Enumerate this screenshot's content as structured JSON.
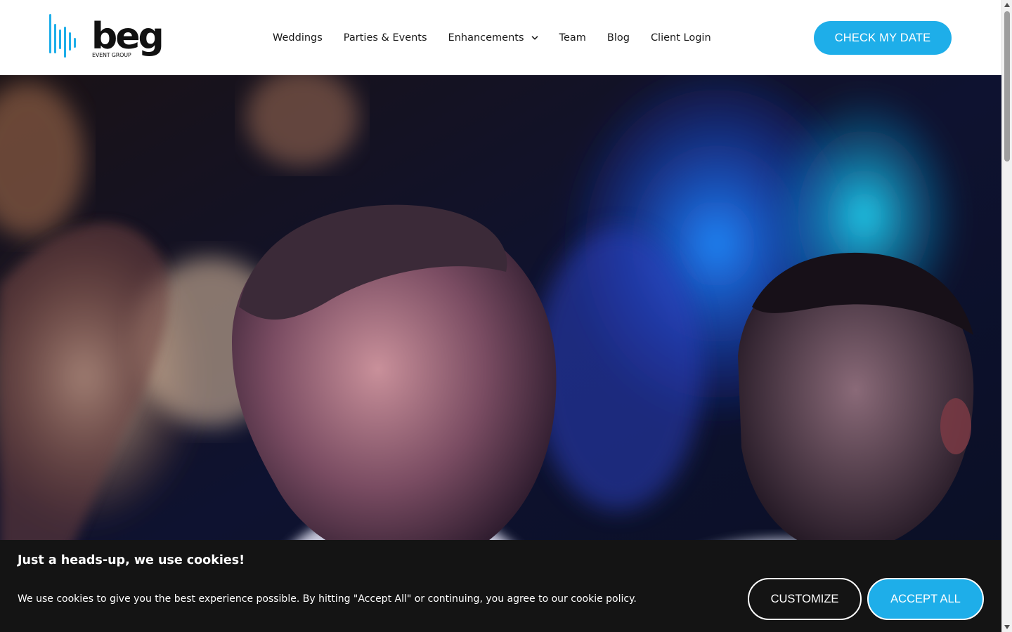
{
  "brand": {
    "logo_word": "beg",
    "logo_sub": "EVENT GROUP",
    "accent_color": "#1eaee9"
  },
  "nav": {
    "items": [
      {
        "label": "Weddings"
      },
      {
        "label": "Parties & Events"
      },
      {
        "label": "Enhancements",
        "icon": "chevron-down-icon"
      },
      {
        "label": "Team"
      },
      {
        "label": "Blog"
      },
      {
        "label": "Client Login"
      }
    ]
  },
  "cta": {
    "label": "CHECK MY DATE"
  },
  "hero": {
    "media": "video-still-people-dancing"
  },
  "cookie_banner": {
    "title": "Just a heads-up, we use cookies!",
    "text": "We use cookies to give you the best experience possible. By hitting \"Accept All\" or continuing, you agree to our cookie policy.",
    "customize_label": "CUSTOMIZE",
    "accept_label": "ACCEPT ALL",
    "background": "#141414"
  }
}
